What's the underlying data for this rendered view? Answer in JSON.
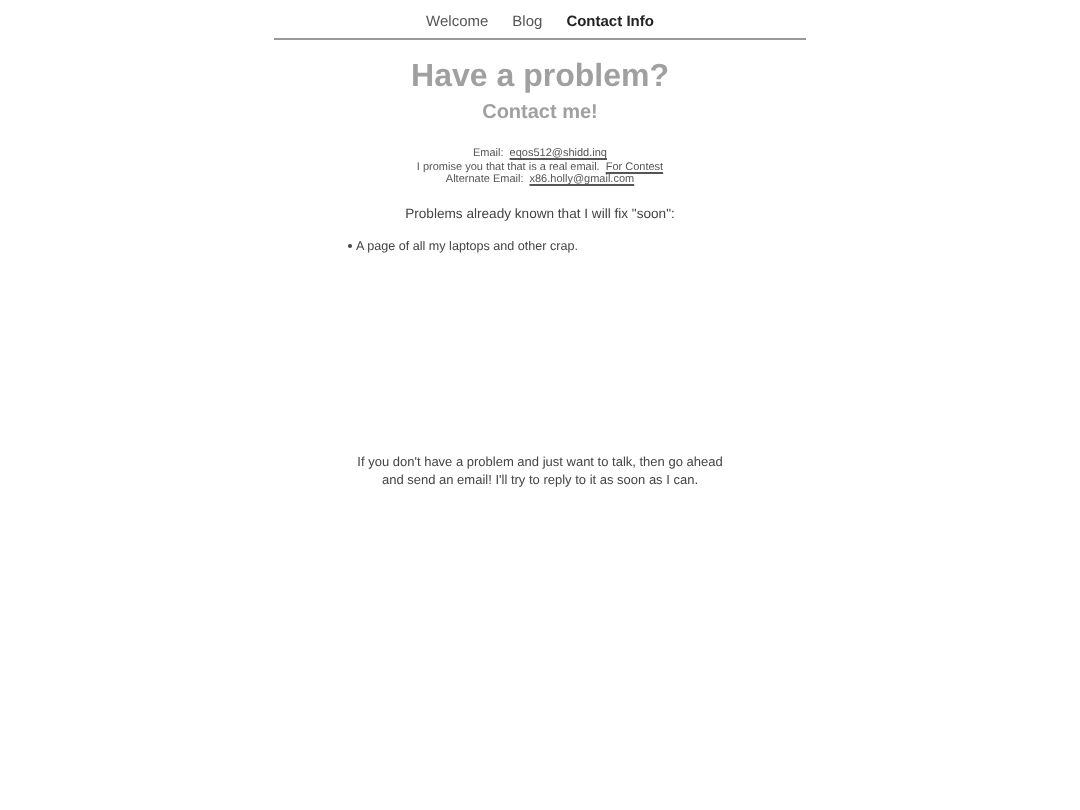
{
  "nav": [
    {
      "label": "Welcome",
      "selected": false
    },
    {
      "label": "Blog",
      "selected": false
    },
    {
      "label": "Contact Info",
      "selected": true
    }
  ],
  "heading": "Have a problem?",
  "subheading": "Contact me!",
  "contact": [
    {
      "label": "Email:",
      "link": "eqos512@shidd.inq"
    },
    {
      "label": "I promise you that that is a real email.",
      "link": "For Contest"
    },
    {
      "label": "Alternate Email:",
      "link": "x86.holly@gmail.com"
    }
  ],
  "known_title": "Problems already known that I will fix \"soon\":",
  "known_problems": [
    "A page of all my laptops and other crap."
  ],
  "closing": [
    "If you don't have a problem and just want to talk, then go ahead",
    "and send an email! I'll try to reply to it as soon as I can."
  ]
}
